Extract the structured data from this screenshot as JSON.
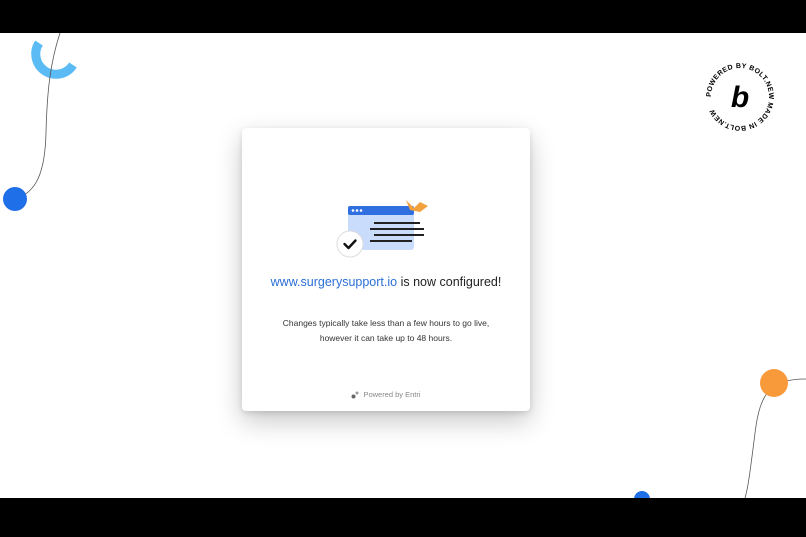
{
  "dialog": {
    "domain": "www.surgerysupport.io",
    "title_suffix": " is now configured!",
    "description": "Changes typically take less than a few hours to go live, however it can take up to 48 hours.",
    "powered_by": "Powered by Entri"
  },
  "badge": {
    "ring_text": "POWERED BY BOLT.NEW MADE IN BOLT.NEW",
    "letter": "b"
  },
  "colors": {
    "accent_blue": "#1f6fe8",
    "light_blue": "#5bbcf5",
    "orange": "#f99a3a",
    "link": "#2b6fd6"
  }
}
